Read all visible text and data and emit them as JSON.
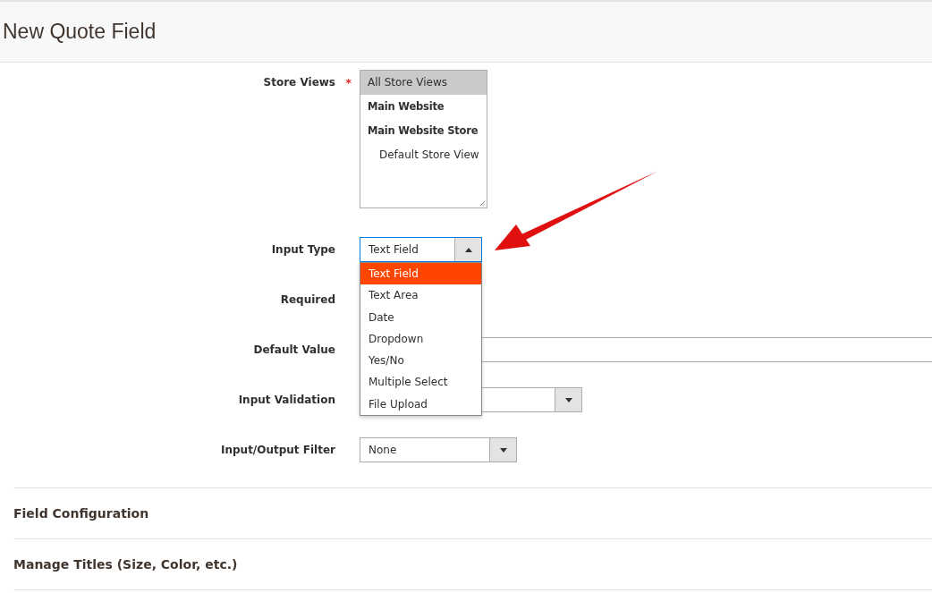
{
  "page_title": "New Quote Field",
  "store_views": {
    "label": "Store Views",
    "required_mark": "*",
    "items": [
      {
        "label": "All Store Views",
        "kind": "all",
        "selected": true
      },
      {
        "label": "Main Website",
        "kind": "group",
        "selected": false
      },
      {
        "label": "Main Website Store",
        "kind": "group",
        "selected": false
      },
      {
        "label": "Default Store View",
        "kind": "view",
        "selected": false
      }
    ]
  },
  "input_type": {
    "label": "Input Type",
    "value": "Text Field",
    "expanded": true,
    "options": [
      {
        "label": "Text Field",
        "selected": true
      },
      {
        "label": "Text Area",
        "selected": false
      },
      {
        "label": "Date",
        "selected": false
      },
      {
        "label": "Dropdown",
        "selected": false
      },
      {
        "label": "Yes/No",
        "selected": false
      },
      {
        "label": "Multiple Select",
        "selected": false
      },
      {
        "label": "File Upload",
        "selected": false
      }
    ]
  },
  "required": {
    "label": "Required"
  },
  "default_value": {
    "label": "Default Value"
  },
  "input_validation": {
    "label": "Input Validation"
  },
  "input_output_filter": {
    "label": "Input/Output Filter",
    "value": "None"
  },
  "sections": [
    {
      "title": "Field Configuration"
    },
    {
      "title": "Manage Titles (Size, Color, etc.)"
    }
  ]
}
